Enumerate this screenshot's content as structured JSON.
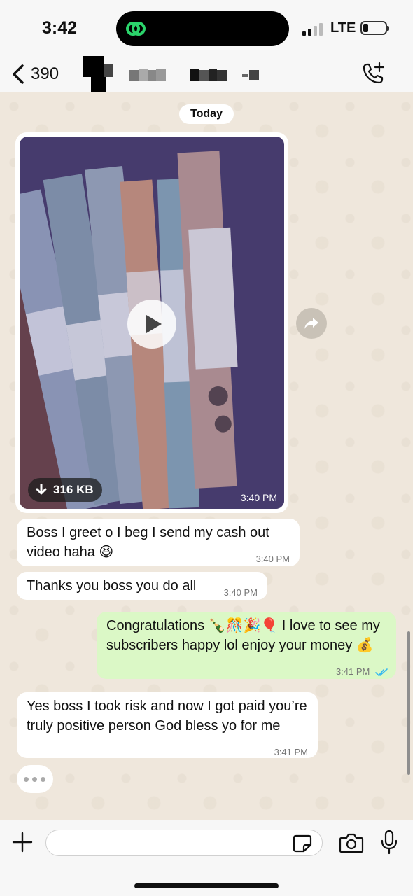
{
  "status_bar": {
    "time": "3:42",
    "network": "LTE"
  },
  "header": {
    "back_count": "390",
    "contact_name": "",
    "icons": {
      "back": "chevron-left-icon",
      "call": "phone-add-icon"
    }
  },
  "chat": {
    "date_label": "Today",
    "video_message": {
      "size_label": "316 KB",
      "time": "3:40 PM",
      "icons": {
        "play": "play-icon",
        "download": "download-icon",
        "forward": "forward-icon"
      }
    },
    "messages": [
      {
        "direction": "in",
        "text": "Boss I greet o I beg I send my cash out video haha 😆",
        "time": "3:40 PM"
      },
      {
        "direction": "in",
        "text": "Thanks you boss you do all",
        "time": "3:40 PM"
      },
      {
        "direction": "out",
        "text": "Congratulations 🍾🎊🎉🎈 I love to see my subscribers happy lol enjoy your money 💰",
        "time": "3:41 PM",
        "status": "read"
      },
      {
        "direction": "in",
        "text": "Yes boss I took risk and now I got paid you’re truly positive person God bless yo for me",
        "time": "3:41 PM"
      }
    ],
    "typing_indicator": "•••"
  },
  "composer": {
    "placeholder": "",
    "icons": {
      "attach": "plus-icon",
      "sticker": "sticker-icon",
      "camera": "camera-icon",
      "mic": "microphone-icon"
    }
  },
  "colors": {
    "chat_background": "#efe7dc",
    "outgoing_bubble": "#dbf8c6",
    "incoming_bubble": "#ffffff",
    "read_ticks": "#34b7f1"
  }
}
